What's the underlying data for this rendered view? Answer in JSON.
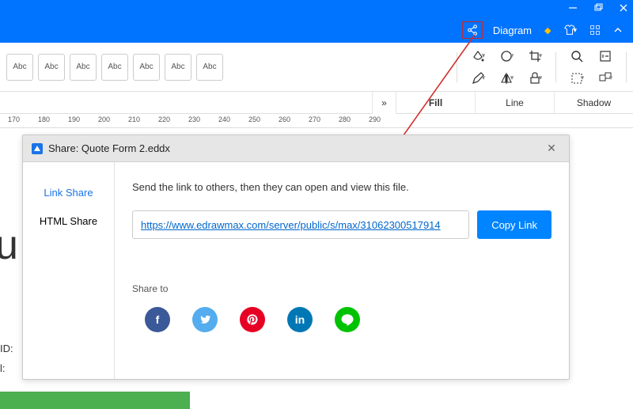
{
  "titlebar": {
    "diagram_label": "Diagram"
  },
  "subtoolbar": {
    "abc": "Abc"
  },
  "tabs": {
    "fill": "Fill",
    "line": "Line",
    "shadow": "Shadow",
    "chev": "»"
  },
  "ruler": {
    "ticks": [
      "170",
      "180",
      "190",
      "200",
      "210",
      "220",
      "230",
      "240",
      "250",
      "260",
      "270",
      "280",
      "290"
    ]
  },
  "dialog": {
    "title": "Share: Quote Form 2.eddx",
    "side": {
      "link": "Link Share",
      "html": "HTML Share"
    },
    "message": "Send the link to others, then they can open and view this file.",
    "link": "https://www.edrawmax.com/server/public/s/max/31062300517914",
    "copy": "Copy Link",
    "share_to": "Share to",
    "icons": {
      "fb": "f",
      "tw": "t",
      "pin": "P",
      "lin": "in",
      "line": "L"
    }
  },
  "bg": {
    "id": " ID:",
    "il": "l:"
  }
}
